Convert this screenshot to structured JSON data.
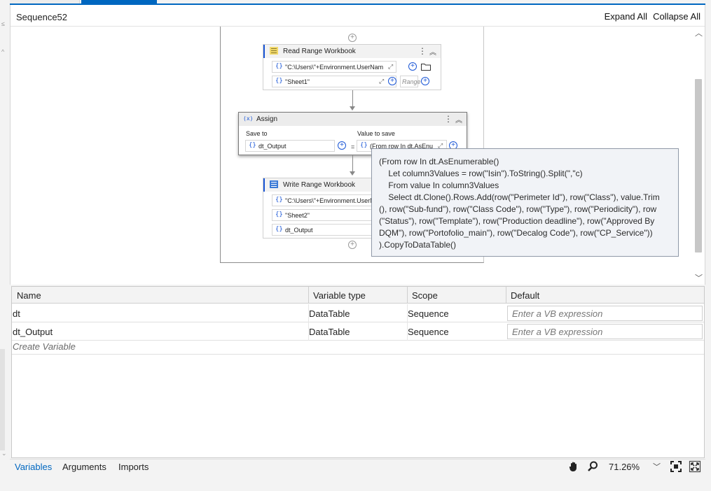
{
  "designer": {
    "sequence_name": "Sequence52",
    "expand_all": "Expand All",
    "collapse_all": "Collapse All"
  },
  "read_range": {
    "title": "Read Range Workbook",
    "path": "\"C:\\Users\\\"+Environment.UserName+\"",
    "sheet": "\"Sheet1\"",
    "range_placeholder": "Range"
  },
  "assign": {
    "title": "Assign",
    "save_to_label": "Save to",
    "value_label": "Value to save",
    "save_to_value": "dt_Output",
    "equals": "=",
    "value": "(From row In dt.AsEnu"
  },
  "write_range": {
    "title": "Write Range Workbook",
    "path": "\"C:\\Users\\\"+Environment.UserNam",
    "sheet": "\"Sheet2\"",
    "datatable": "dt_Output"
  },
  "tooltip": {
    "text": "(From row In dt.AsEnumerable()\n    Let column3Values = row(\"Isin\").ToString().Split(\",\"c)\n    From value In column3Values\n    Select dt.Clone().Rows.Add(row(\"Perimeter Id\"), row(\"Class\"), value.Trim\n(), row(\"Sub-fund\"), row(\"Class Code\"), row(\"Type\"), row(\"Periodicity\"), row\n(\"Status\"), row(\"Template\"), row(\"Production deadline\"), row(\"Approved By\nDQM\"), row(\"Portofolio_main\"), row(\"Decalog Code\"), row(\"CP_Service\"))\n).CopyToDataTable()"
  },
  "variables": {
    "columns": [
      "Name",
      "Variable type",
      "Scope",
      "Default"
    ],
    "rows": [
      {
        "name": "dt",
        "type": "DataTable",
        "scope": "Sequence",
        "default_placeholder": "Enter a VB expression"
      },
      {
        "name": "dt_Output",
        "type": "DataTable",
        "scope": "Sequence",
        "default_placeholder": "Enter a VB expression"
      }
    ],
    "create_label": "Create Variable"
  },
  "statusbar": {
    "tabs": [
      "Variables",
      "Arguments",
      "Imports"
    ],
    "zoom": "71.26%",
    "active_tab_color": "#0067c0"
  },
  "colors": {
    "accent": "#0067c0",
    "expression_blue": "#1a56d6"
  },
  "icons": [
    "hand-pan-icon",
    "zoom-magnifier-icon",
    "fit-to-screen-icon",
    "reset-zoom-icon",
    "chevron-down-icon",
    "plus-circle-icon",
    "folder-icon",
    "expand-editor-icon",
    "kebab-menu-icon",
    "collapse-chevron-icon",
    "excel-read-icon",
    "excel-write-icon",
    "assign-x-icon"
  ]
}
